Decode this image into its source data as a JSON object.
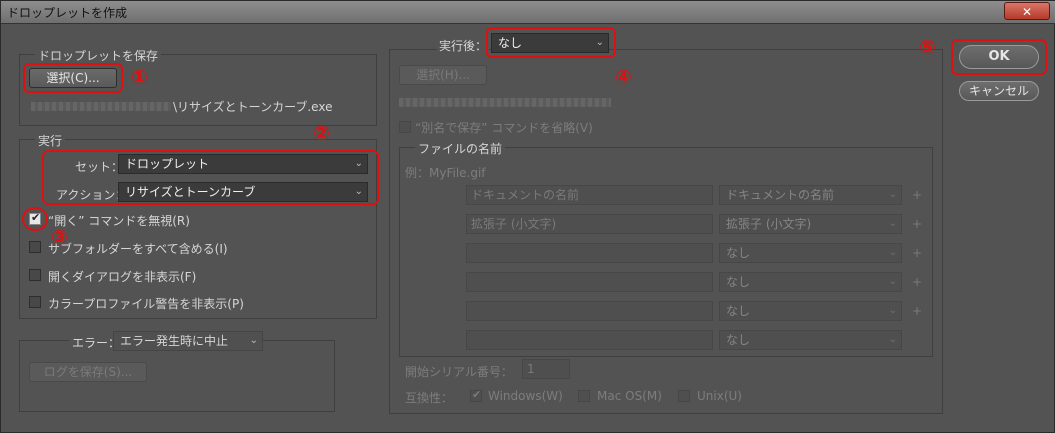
{
  "window": {
    "title": "ドロップレットを作成",
    "close": "✕"
  },
  "save": {
    "group": "ドロップレットを保存",
    "choose": "選択(C)...",
    "path_suffix": "\\リサイズとトーンカーブ.exe"
  },
  "exec": {
    "group": "実行",
    "set_label": "セット：",
    "set_value": "ドロップレット",
    "action_label": "アクション：",
    "action_value": "リサイズとトーンカーブ",
    "checks": [
      "“開く” コマンドを無視(R)",
      "サブフォルダーをすべて含める(I)",
      "開くダイアログを非表示(F)",
      "カラープロファイル警告を非表示(P)"
    ]
  },
  "error": {
    "label": "エラー：",
    "value": "エラー発生時に中止",
    "save_log": "ログを保存(S)..."
  },
  "after": {
    "label": "実行後：",
    "value": "なし",
    "choose": "選択(H)...",
    "override": "“別名で保存” コマンドを省略(V)",
    "filename_group": "ファイルの名前",
    "example": "例：MyFile.gif",
    "rows": [
      {
        "left": "ドキュメントの名前",
        "right": "ドキュメントの名前"
      },
      {
        "left": "拡張子 (小文字)",
        "right": "拡張子 (小文字)"
      },
      {
        "left": "",
        "right": "なし"
      },
      {
        "left": "",
        "right": "なし"
      },
      {
        "left": "",
        "right": "なし"
      },
      {
        "left": "",
        "right": "なし"
      }
    ],
    "plus": "+",
    "serial_label": "開始シリアル番号：",
    "serial_value": "1",
    "compat_label": "互換性：",
    "compat": [
      "Windows(W)",
      "Mac OS(M)",
      "Unix(U)"
    ]
  },
  "ok": "OK",
  "cancel": "キャンセル",
  "markers": [
    "①",
    "②",
    "③",
    "④",
    "⑤"
  ],
  "colors": {
    "highlight": "#e01010",
    "background": "#535353"
  }
}
